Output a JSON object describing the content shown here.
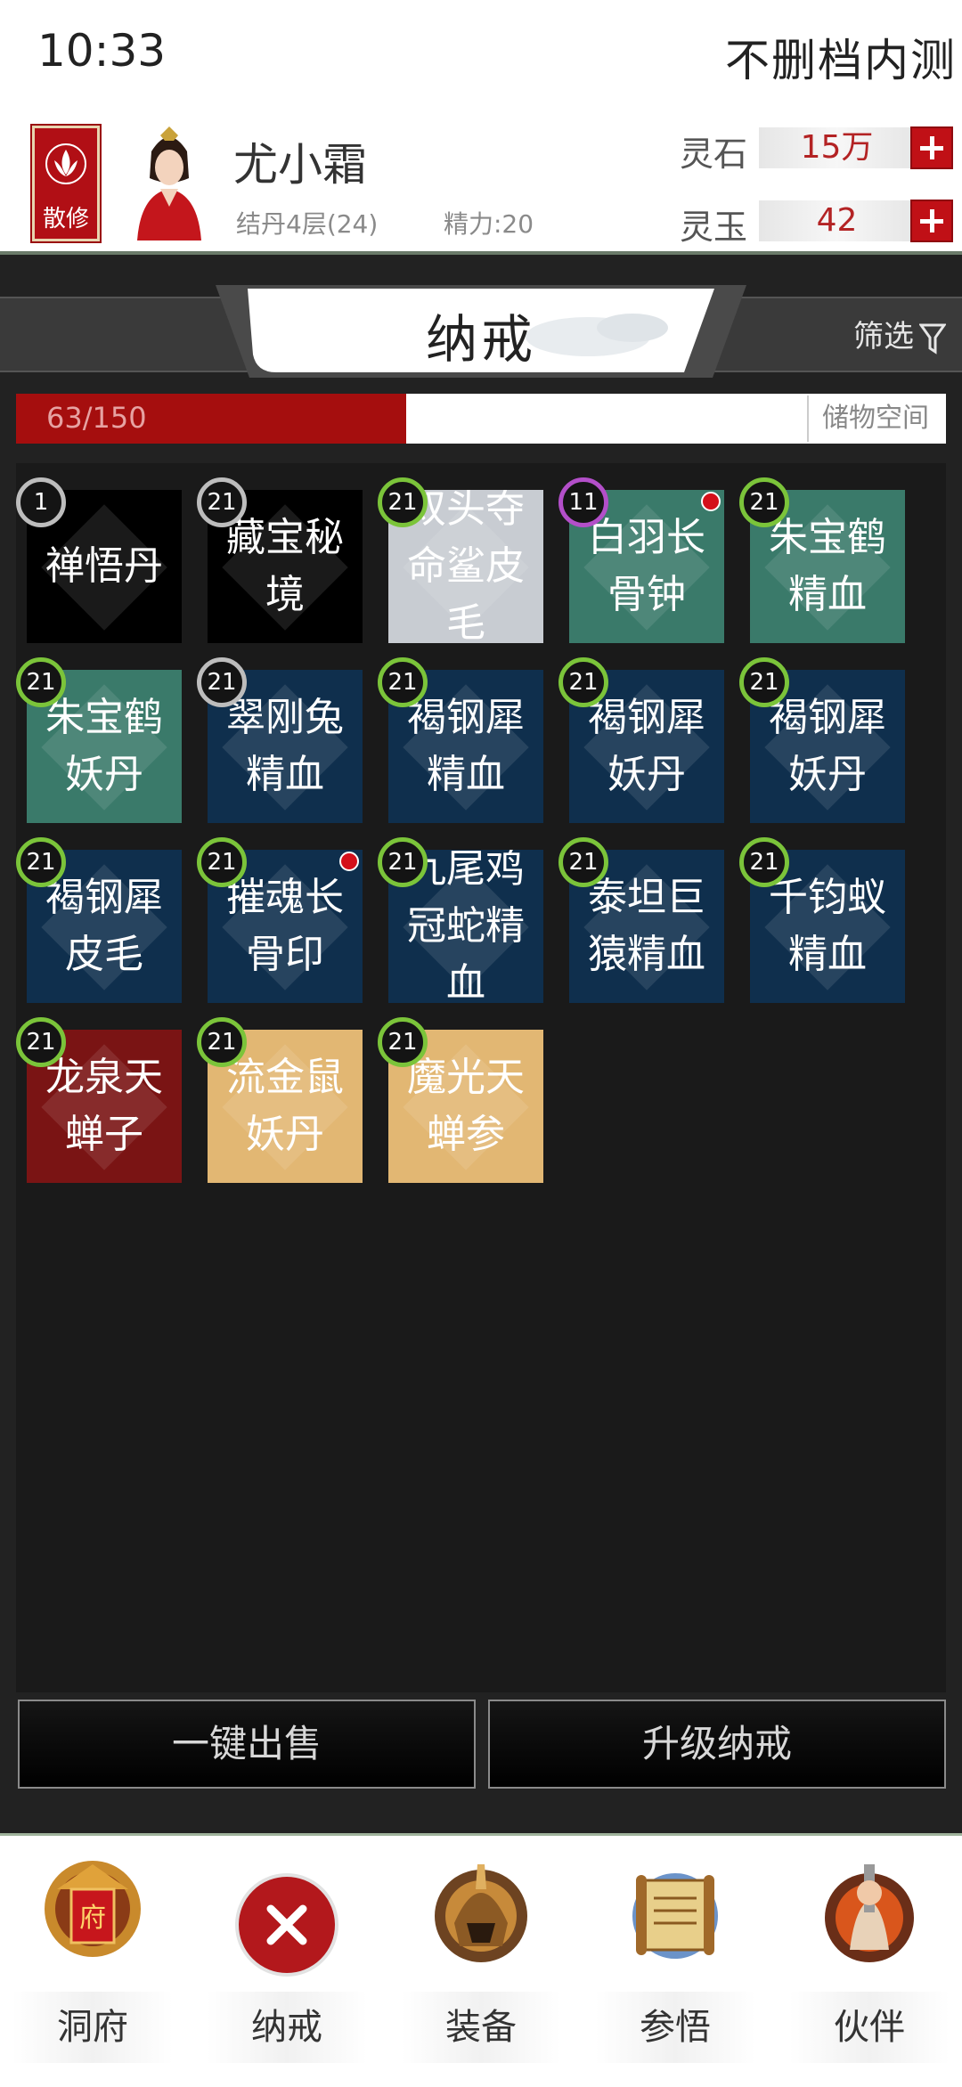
{
  "status": {
    "time": "10:33",
    "title": "不删档内测"
  },
  "player": {
    "sect_label": "散修",
    "name": "尤小霜",
    "level": "结丹4层(24)",
    "energy": "精力:20"
  },
  "resources": [
    {
      "label": "灵石",
      "value": "15万"
    },
    {
      "label": "灵玉",
      "value": "42"
    }
  ],
  "panel": {
    "tab_title": "纳戒",
    "filter_label": "筛选"
  },
  "capacity": {
    "text": "63/150",
    "used": 63,
    "total": 150,
    "storage_label": "储物空间"
  },
  "items": [
    {
      "name": "禅悟丹",
      "level": "1",
      "bg": "#000000",
      "ring": "#bdbdbd",
      "dot": false
    },
    {
      "name": "藏宝秘境",
      "level": "21",
      "bg": "#000000",
      "ring": "#bdbdbd",
      "dot": false
    },
    {
      "name": "双头夺命鲨皮毛",
      "level": "21",
      "bg": "#c8ccd2",
      "ring": "#7bc43a",
      "dot": false
    },
    {
      "name": "白羽长骨钟",
      "level": "11",
      "bg": "#3a7a6a",
      "ring": "#b34fc9",
      "dot": true
    },
    {
      "name": "朱宝鹤精血",
      "level": "21",
      "bg": "#3a7a6a",
      "ring": "#7bc43a",
      "dot": false
    },
    {
      "name": "朱宝鹤妖丹",
      "level": "21",
      "bg": "#3a7a6a",
      "ring": "#7bc43a",
      "dot": false
    },
    {
      "name": "翠刚兔精血",
      "level": "21",
      "bg": "#0f2f4d",
      "ring": "#bdbdbd",
      "dot": false
    },
    {
      "name": "褐钢犀精血",
      "level": "21",
      "bg": "#0f2f4d",
      "ring": "#7bc43a",
      "dot": false
    },
    {
      "name": "褐钢犀妖丹",
      "level": "21",
      "bg": "#0f2f4d",
      "ring": "#7bc43a",
      "dot": false
    },
    {
      "name": "褐钢犀妖丹",
      "level": "21",
      "bg": "#0f2f4d",
      "ring": "#7bc43a",
      "dot": false
    },
    {
      "name": "褐钢犀皮毛",
      "level": "21",
      "bg": "#0f2f4d",
      "ring": "#7bc43a",
      "dot": false
    },
    {
      "name": "摧魂长骨印",
      "level": "21",
      "bg": "#0f2f4d",
      "ring": "#7bc43a",
      "dot": true
    },
    {
      "name": "九尾鸡冠蛇精血",
      "level": "21",
      "bg": "#0f2f4d",
      "ring": "#7bc43a",
      "dot": false
    },
    {
      "name": "泰坦巨猿精血",
      "level": "21",
      "bg": "#0f2f4d",
      "ring": "#7bc43a",
      "dot": false
    },
    {
      "name": "千钧蚁精血",
      "level": "21",
      "bg": "#0f2f4d",
      "ring": "#7bc43a",
      "dot": false
    },
    {
      "name": "龙泉天蝉子",
      "level": "21",
      "bg": "#7a1414",
      "ring": "#7bc43a",
      "dot": false
    },
    {
      "name": "流金鼠妖丹",
      "level": "21",
      "bg": "#e2b773",
      "ring": "#7bc43a",
      "dot": false
    },
    {
      "name": "魔光天蝉参",
      "level": "21",
      "bg": "#e2b773",
      "ring": "#7bc43a",
      "dot": false
    }
  ],
  "actions": {
    "sell_all": "一键出售",
    "upgrade": "升级纳戒"
  },
  "nav": [
    {
      "label": "洞府",
      "icon": "cave-mansion-icon"
    },
    {
      "label": "纳戒",
      "icon": "close-icon"
    },
    {
      "label": "装备",
      "icon": "helmet-icon"
    },
    {
      "label": "参悟",
      "icon": "scroll-icon"
    },
    {
      "label": "伙伴",
      "icon": "partner-icon"
    }
  ]
}
